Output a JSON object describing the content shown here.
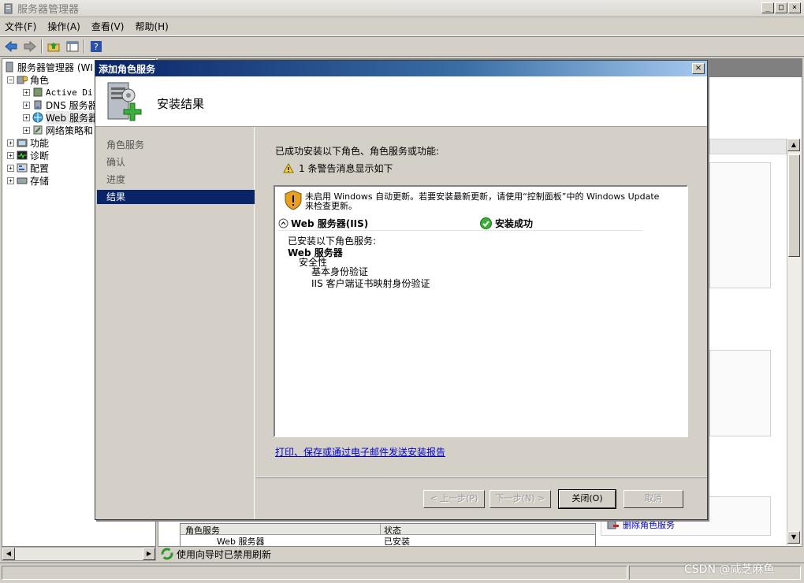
{
  "window": {
    "title": "服务器管理器",
    "minimize": "_",
    "maximize": "□",
    "close": "×"
  },
  "menu": [
    "文件(F)",
    "操作(A)",
    "查看(V)",
    "帮助(H)"
  ],
  "tree": {
    "root": "服务器管理器 (WI",
    "roles": "角色",
    "role_items": [
      "Active Di",
      "DNS 服务器",
      "Web 服务器",
      "网络策略和"
    ],
    "features": "功能",
    "diagnostics": "诊断",
    "configuration": "配置",
    "storage": "存储"
  },
  "right_pane": {
    "table_headers": [
      "角色服务",
      "状态"
    ],
    "table_row": [
      "Web 服务器",
      "已安装"
    ],
    "remove_link": "删除角色服务"
  },
  "status": {
    "text": "使用向导时已禁用刷新"
  },
  "dialog": {
    "title": "添加角色服务",
    "close": "×",
    "heading": "安装结果",
    "nav": [
      "角色服务",
      "确认",
      "进度",
      "结果"
    ],
    "intro": "已成功安装以下角色、角色服务或功能:",
    "warning_count": "1 条警告消息显示如下",
    "warning_line1": "未启用 Windows 自动更新。若要安装最新更新，请使用“控制面板”中的 Windows Update",
    "warning_line2": "来检查更新。",
    "section_title": "Web 服务器(IIS)",
    "section_status": "安装成功",
    "installed_label": "已安装以下角色服务:",
    "tree_root": "Web 服务器",
    "tree_group": "安全性",
    "tree_items": [
      "基本身份验证",
      "IIS 客户端证书映射身份验证"
    ],
    "report_link": "打印、保存或通过电子邮件发送安装报告",
    "buttons": {
      "prev": "< 上一步(P)",
      "next": "下一步(N) >",
      "close": "关闭(O)",
      "cancel": "取消"
    }
  },
  "watermark": "CSDN @咸芝麻鱼",
  "colors": {
    "dialog_title_start": "#0a246a",
    "selection": "#0a246a",
    "link": "#0000cc"
  }
}
